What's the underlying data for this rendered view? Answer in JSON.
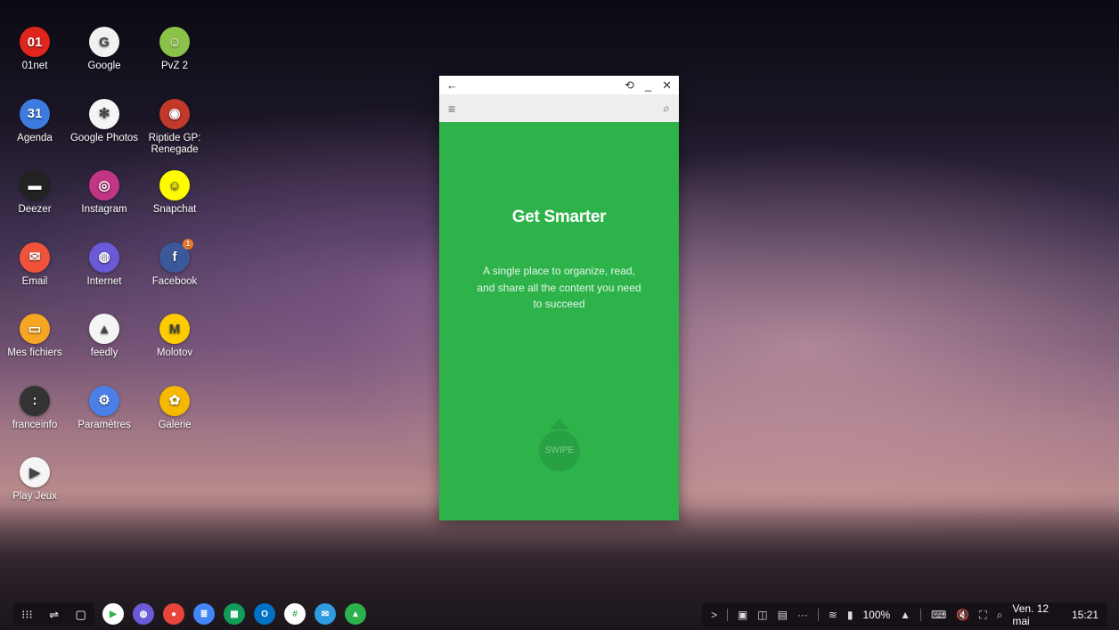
{
  "desktop_icons": [
    {
      "label": "01net",
      "glyph": "01",
      "color": "#e0241e"
    },
    {
      "label": "Google",
      "glyph": "G",
      "color": "#f1f1f1"
    },
    {
      "label": "PvZ 2",
      "glyph": "☺",
      "color": "#8bc34a"
    },
    {
      "label": "Agenda",
      "glyph": "31",
      "color": "#3d7be0"
    },
    {
      "label": "Google Photos",
      "glyph": "✻",
      "color": "#f5f5f5"
    },
    {
      "label": "Riptide GP: Renegade",
      "glyph": "◉",
      "color": "#c0392b"
    },
    {
      "label": "Deezer",
      "glyph": "▬",
      "color": "#222222"
    },
    {
      "label": "Instagram",
      "glyph": "◎",
      "color": "#c13584"
    },
    {
      "label": "Snapchat",
      "glyph": "☺",
      "color": "#fffc00"
    },
    {
      "label": "Email",
      "glyph": "✉",
      "color": "#f0533a"
    },
    {
      "label": "Internet",
      "glyph": "◍",
      "color": "#6a5ad8"
    },
    {
      "label": "Facebook",
      "glyph": "f",
      "color": "#3b5998",
      "badge": "1"
    },
    {
      "label": "Mes fichiers",
      "glyph": "▭",
      "color": "#f5a623"
    },
    {
      "label": "feedly",
      "glyph": "▲",
      "color": "#f4f4f4"
    },
    {
      "label": "Molotov",
      "glyph": "M",
      "color": "#ffcc00"
    },
    {
      "label": "franceinfo",
      "glyph": ":",
      "color": "#333333"
    },
    {
      "label": "Paramètres",
      "glyph": "⚙",
      "color": "#4a7fe8"
    },
    {
      "label": "Galerie",
      "glyph": "✿",
      "color": "#f7b800"
    },
    {
      "label": "Play Jeux",
      "glyph": "▶",
      "color": "#f5f5f5"
    }
  ],
  "window": {
    "back_icon": "←",
    "rotate_icon": "⟲",
    "minimize_icon": "_",
    "close_icon": "✕",
    "menu_icon": "≡",
    "search_icon": "⌕",
    "headline": "Get Smarter",
    "tagline": "A single place to organize, read, and share all the content you need to succeed",
    "swipe_label": "SWIPE",
    "accent": "#2db34a"
  },
  "taskbar": {
    "apps_icon": "⁝⁝⁝",
    "recent_icon": "⇌",
    "home_icon": "▢",
    "dock": [
      {
        "name": "play-store",
        "glyph": "▶",
        "color": "#ffffff"
      },
      {
        "name": "internet",
        "glyph": "◍",
        "color": "#6a5ad8"
      },
      {
        "name": "chrome",
        "glyph": "●",
        "color": "#e8453c"
      },
      {
        "name": "google-docs",
        "glyph": "≣",
        "color": "#4285f4"
      },
      {
        "name": "google-sheets",
        "glyph": "▦",
        "color": "#0f9d58"
      },
      {
        "name": "outlook",
        "glyph": "O",
        "color": "#0072c6"
      },
      {
        "name": "slack",
        "glyph": "#",
        "color": "#ffffff"
      },
      {
        "name": "mail",
        "glyph": "✉",
        "color": "#2f9be0"
      },
      {
        "name": "feedly",
        "glyph": "▲",
        "color": "#2bb24c"
      }
    ],
    "tray": {
      "expand_icon": ">",
      "gallery_icon": "▣",
      "stack_icon": "◫",
      "briefcase_icon": "▤",
      "more_icon": "···",
      "wifi_icon": "≋",
      "signal_icon": "▮",
      "battery": "100%",
      "battery_icon": "▮",
      "up_icon": "▲",
      "keyboard_icon": "⌨",
      "mute_icon": "🔇",
      "screenshot_icon": "⛶",
      "search_icon": "⌕",
      "date": "Ven. 12 mai",
      "time": "15:21"
    }
  }
}
